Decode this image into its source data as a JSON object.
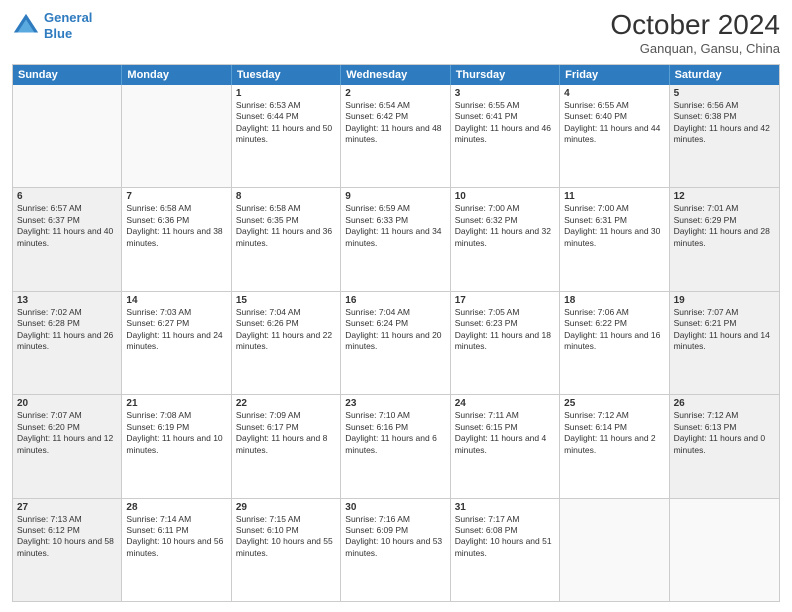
{
  "header": {
    "logo_line1": "General",
    "logo_line2": "Blue",
    "month": "October 2024",
    "location": "Ganquan, Gansu, China"
  },
  "days_of_week": [
    "Sunday",
    "Monday",
    "Tuesday",
    "Wednesday",
    "Thursday",
    "Friday",
    "Saturday"
  ],
  "weeks": [
    [
      {
        "day": "",
        "sunrise": "",
        "sunset": "",
        "daylight": "",
        "empty": true
      },
      {
        "day": "",
        "sunrise": "",
        "sunset": "",
        "daylight": "",
        "empty": true
      },
      {
        "day": "1",
        "sunrise": "Sunrise: 6:53 AM",
        "sunset": "Sunset: 6:44 PM",
        "daylight": "Daylight: 11 hours and 50 minutes."
      },
      {
        "day": "2",
        "sunrise": "Sunrise: 6:54 AM",
        "sunset": "Sunset: 6:42 PM",
        "daylight": "Daylight: 11 hours and 48 minutes."
      },
      {
        "day": "3",
        "sunrise": "Sunrise: 6:55 AM",
        "sunset": "Sunset: 6:41 PM",
        "daylight": "Daylight: 11 hours and 46 minutes."
      },
      {
        "day": "4",
        "sunrise": "Sunrise: 6:55 AM",
        "sunset": "Sunset: 6:40 PM",
        "daylight": "Daylight: 11 hours and 44 minutes."
      },
      {
        "day": "5",
        "sunrise": "Sunrise: 6:56 AM",
        "sunset": "Sunset: 6:38 PM",
        "daylight": "Daylight: 11 hours and 42 minutes."
      }
    ],
    [
      {
        "day": "6",
        "sunrise": "Sunrise: 6:57 AM",
        "sunset": "Sunset: 6:37 PM",
        "daylight": "Daylight: 11 hours and 40 minutes."
      },
      {
        "day": "7",
        "sunrise": "Sunrise: 6:58 AM",
        "sunset": "Sunset: 6:36 PM",
        "daylight": "Daylight: 11 hours and 38 minutes."
      },
      {
        "day": "8",
        "sunrise": "Sunrise: 6:58 AM",
        "sunset": "Sunset: 6:35 PM",
        "daylight": "Daylight: 11 hours and 36 minutes."
      },
      {
        "day": "9",
        "sunrise": "Sunrise: 6:59 AM",
        "sunset": "Sunset: 6:33 PM",
        "daylight": "Daylight: 11 hours and 34 minutes."
      },
      {
        "day": "10",
        "sunrise": "Sunrise: 7:00 AM",
        "sunset": "Sunset: 6:32 PM",
        "daylight": "Daylight: 11 hours and 32 minutes."
      },
      {
        "day": "11",
        "sunrise": "Sunrise: 7:00 AM",
        "sunset": "Sunset: 6:31 PM",
        "daylight": "Daylight: 11 hours and 30 minutes."
      },
      {
        "day": "12",
        "sunrise": "Sunrise: 7:01 AM",
        "sunset": "Sunset: 6:29 PM",
        "daylight": "Daylight: 11 hours and 28 minutes."
      }
    ],
    [
      {
        "day": "13",
        "sunrise": "Sunrise: 7:02 AM",
        "sunset": "Sunset: 6:28 PM",
        "daylight": "Daylight: 11 hours and 26 minutes."
      },
      {
        "day": "14",
        "sunrise": "Sunrise: 7:03 AM",
        "sunset": "Sunset: 6:27 PM",
        "daylight": "Daylight: 11 hours and 24 minutes."
      },
      {
        "day": "15",
        "sunrise": "Sunrise: 7:04 AM",
        "sunset": "Sunset: 6:26 PM",
        "daylight": "Daylight: 11 hours and 22 minutes."
      },
      {
        "day": "16",
        "sunrise": "Sunrise: 7:04 AM",
        "sunset": "Sunset: 6:24 PM",
        "daylight": "Daylight: 11 hours and 20 minutes."
      },
      {
        "day": "17",
        "sunrise": "Sunrise: 7:05 AM",
        "sunset": "Sunset: 6:23 PM",
        "daylight": "Daylight: 11 hours and 18 minutes."
      },
      {
        "day": "18",
        "sunrise": "Sunrise: 7:06 AM",
        "sunset": "Sunset: 6:22 PM",
        "daylight": "Daylight: 11 hours and 16 minutes."
      },
      {
        "day": "19",
        "sunrise": "Sunrise: 7:07 AM",
        "sunset": "Sunset: 6:21 PM",
        "daylight": "Daylight: 11 hours and 14 minutes."
      }
    ],
    [
      {
        "day": "20",
        "sunrise": "Sunrise: 7:07 AM",
        "sunset": "Sunset: 6:20 PM",
        "daylight": "Daylight: 11 hours and 12 minutes."
      },
      {
        "day": "21",
        "sunrise": "Sunrise: 7:08 AM",
        "sunset": "Sunset: 6:19 PM",
        "daylight": "Daylight: 11 hours and 10 minutes."
      },
      {
        "day": "22",
        "sunrise": "Sunrise: 7:09 AM",
        "sunset": "Sunset: 6:17 PM",
        "daylight": "Daylight: 11 hours and 8 minutes."
      },
      {
        "day": "23",
        "sunrise": "Sunrise: 7:10 AM",
        "sunset": "Sunset: 6:16 PM",
        "daylight": "Daylight: 11 hours and 6 minutes."
      },
      {
        "day": "24",
        "sunrise": "Sunrise: 7:11 AM",
        "sunset": "Sunset: 6:15 PM",
        "daylight": "Daylight: 11 hours and 4 minutes."
      },
      {
        "day": "25",
        "sunrise": "Sunrise: 7:12 AM",
        "sunset": "Sunset: 6:14 PM",
        "daylight": "Daylight: 11 hours and 2 minutes."
      },
      {
        "day": "26",
        "sunrise": "Sunrise: 7:12 AM",
        "sunset": "Sunset: 6:13 PM",
        "daylight": "Daylight: 11 hours and 0 minutes."
      }
    ],
    [
      {
        "day": "27",
        "sunrise": "Sunrise: 7:13 AM",
        "sunset": "Sunset: 6:12 PM",
        "daylight": "Daylight: 10 hours and 58 minutes."
      },
      {
        "day": "28",
        "sunrise": "Sunrise: 7:14 AM",
        "sunset": "Sunset: 6:11 PM",
        "daylight": "Daylight: 10 hours and 56 minutes."
      },
      {
        "day": "29",
        "sunrise": "Sunrise: 7:15 AM",
        "sunset": "Sunset: 6:10 PM",
        "daylight": "Daylight: 10 hours and 55 minutes."
      },
      {
        "day": "30",
        "sunrise": "Sunrise: 7:16 AM",
        "sunset": "Sunset: 6:09 PM",
        "daylight": "Daylight: 10 hours and 53 minutes."
      },
      {
        "day": "31",
        "sunrise": "Sunrise: 7:17 AM",
        "sunset": "Sunset: 6:08 PM",
        "daylight": "Daylight: 10 hours and 51 minutes."
      },
      {
        "day": "",
        "sunrise": "",
        "sunset": "",
        "daylight": "",
        "empty": true
      },
      {
        "day": "",
        "sunrise": "",
        "sunset": "",
        "daylight": "",
        "empty": true
      }
    ]
  ]
}
